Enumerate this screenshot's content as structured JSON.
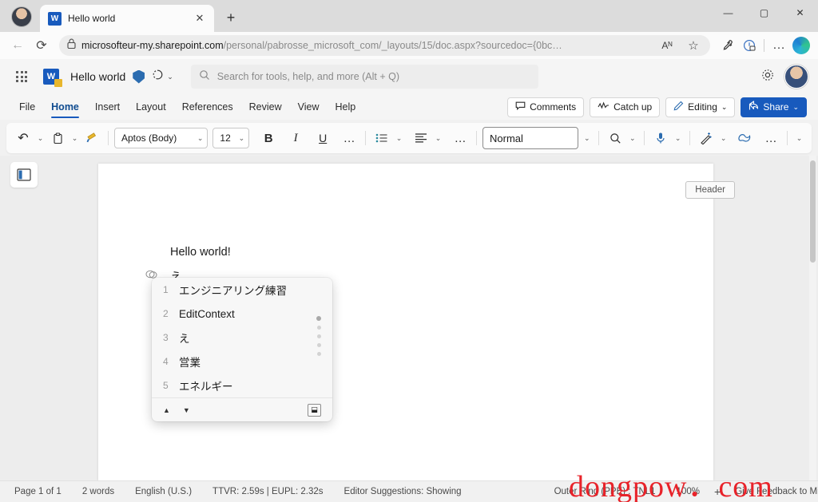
{
  "browser": {
    "tab": {
      "title": "Hello world",
      "favicon": "word-icon",
      "close_label": "✕"
    },
    "new_tab_label": "+",
    "window_controls": {
      "minimize": "—",
      "maximize": "▢",
      "close": "✕"
    },
    "back_label": "←",
    "reload_label": "⟳",
    "url_bold": "microsofteur-my.sharepoint.com",
    "url_rest": "/personal/pabrosse_microsoft_com/_layouts/15/doc.aspx?sourcedoc={0bc…",
    "lock_icon": "padlock-icon",
    "read_aloud_label": "Aᴺ",
    "favorite_label": "☆",
    "split_screen_label": "eyedropper-icon",
    "collections_label": "⊘",
    "more_label": "…",
    "copilot_label": "copilot-icon"
  },
  "office_header": {
    "waffle_label": "app-launcher",
    "app_icon": "W",
    "doc_name": "Hello world",
    "shield_label": "protected-icon",
    "autosave_label": "↻",
    "autosave_caret": "⌄",
    "search": {
      "placeholder": "Search for tools, help, and more (Alt + Q)",
      "icon": "search-icon"
    },
    "settings_label": "⚙",
    "avatar_label": "user-avatar"
  },
  "ribbon": {
    "tabs": [
      {
        "label": "File",
        "active": false
      },
      {
        "label": "Home",
        "active": true
      },
      {
        "label": "Insert",
        "active": false
      },
      {
        "label": "Layout",
        "active": false
      },
      {
        "label": "References",
        "active": false
      },
      {
        "label": "Review",
        "active": false
      },
      {
        "label": "View",
        "active": false
      },
      {
        "label": "Help",
        "active": false
      }
    ],
    "comments_label": "Comments",
    "catchup_label": "Catch up",
    "editing_label": "Editing",
    "editing_caret": "⌄",
    "share_label": "Share",
    "share_caret": "⌄"
  },
  "toolbar": {
    "undo_label": "↶",
    "undo_caret": "⌄",
    "paste_label": "clipboard-icon",
    "paste_caret": "⌄",
    "format_painter_label": "format-painter-icon",
    "font_name": "Aptos (Body)",
    "font_size": "12",
    "bold_label": "B",
    "italic_label": "I",
    "underline_label": "U",
    "more_font_label": "…",
    "bullets_label": "bulleted-list-icon",
    "bullets_caret": "⌄",
    "align_label": "align-icon",
    "align_caret": "⌄",
    "more_para_label": "…",
    "style_name": "Normal",
    "style_caret": "⌄",
    "find_label": "search-icon",
    "find_caret": "⌄",
    "dictate_label": "microphone-icon",
    "dictate_caret": "⌄",
    "designer_label": "magic-wand-icon",
    "designer_caret": "⌄",
    "copilot_label": "copilot-icon",
    "more_tools_label": "…",
    "collapse_label": "⌄",
    "caret": "⌄"
  },
  "document": {
    "outline_toggle_label": "navigation-pane-icon",
    "header_chip_label": "Header",
    "body_line": "Hello world!",
    "paragraph_mark": "⌗",
    "ime_composition_text": "え"
  },
  "ime_popup": {
    "candidates": [
      {
        "index": "1",
        "text": "エンジニアリング練習"
      },
      {
        "index": "2",
        "text": "EditContext"
      },
      {
        "index": "3",
        "text": "え"
      },
      {
        "index": "4",
        "text": "営業"
      },
      {
        "index": "5",
        "text": "エネルギー"
      }
    ],
    "prev_label": "▲",
    "next_label": "▼",
    "pin_label": "⬓"
  },
  "statusbar": {
    "page": "Page 1 of 1",
    "words": "2 words",
    "language": "English (U.S.)",
    "telemetry": "TTVR: 2.59s | EUPL: 2.32s",
    "editor": "Editor Suggestions: Showing",
    "ring": "Outer Ring (PPE) : TNL1",
    "zoom": "100%",
    "zoom_plus": "+",
    "feedback": "Give Feedback to Microsoft"
  },
  "watermark": {
    "text": "dongpow．com"
  },
  "colors": {
    "accent": "#185abd",
    "tab_active": "#0f4b8f",
    "watermark": "#e8232a",
    "share_bg": "#185abd"
  }
}
